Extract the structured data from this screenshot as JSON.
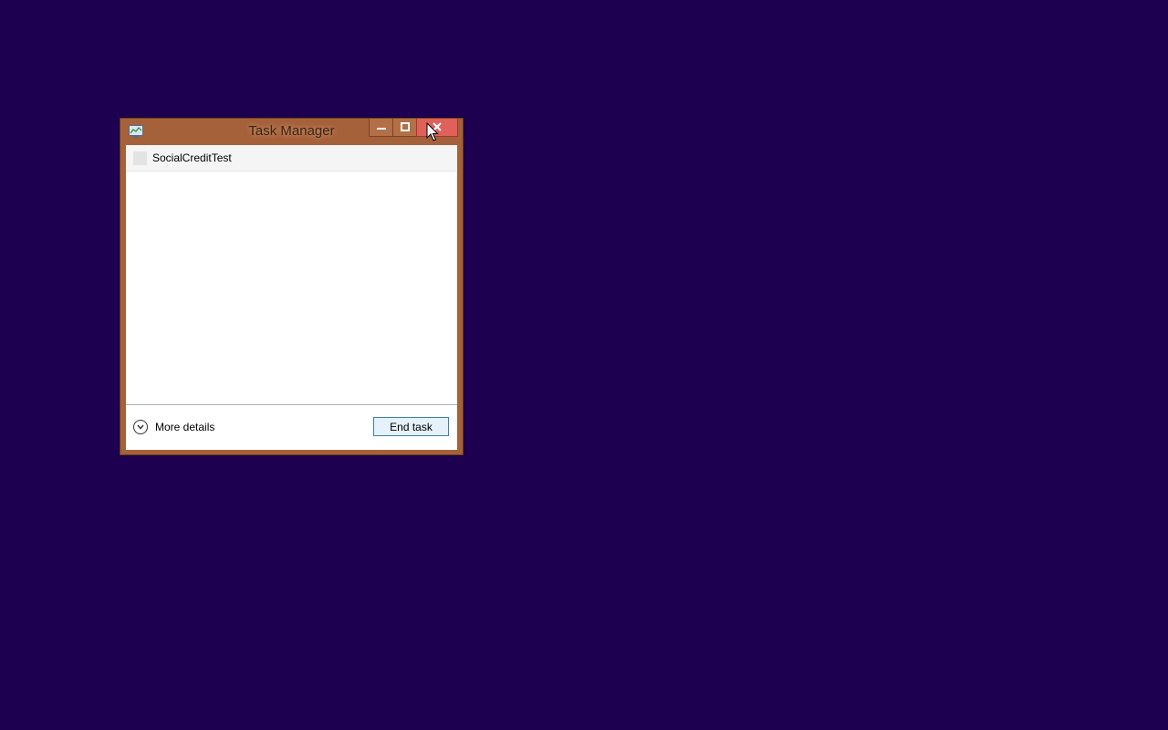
{
  "desktop": {
    "background_color": "#1e0050"
  },
  "window": {
    "title": "Task Manager",
    "frame_color": "#a5613a",
    "close_button_color": "#e0605a",
    "app_icon": "task-manager-icon",
    "caption_buttons": [
      "minimize-icon",
      "maximize-icon",
      "close-icon"
    ]
  },
  "process_list": {
    "items": [
      {
        "label": "SocialCreditTest",
        "icon": "app-icon-blank"
      }
    ]
  },
  "footer": {
    "more_details_label": "More details",
    "more_details_icon": "chevron-down-icon",
    "end_task_label": "End task",
    "end_task_border_color": "#3c7fb1"
  }
}
